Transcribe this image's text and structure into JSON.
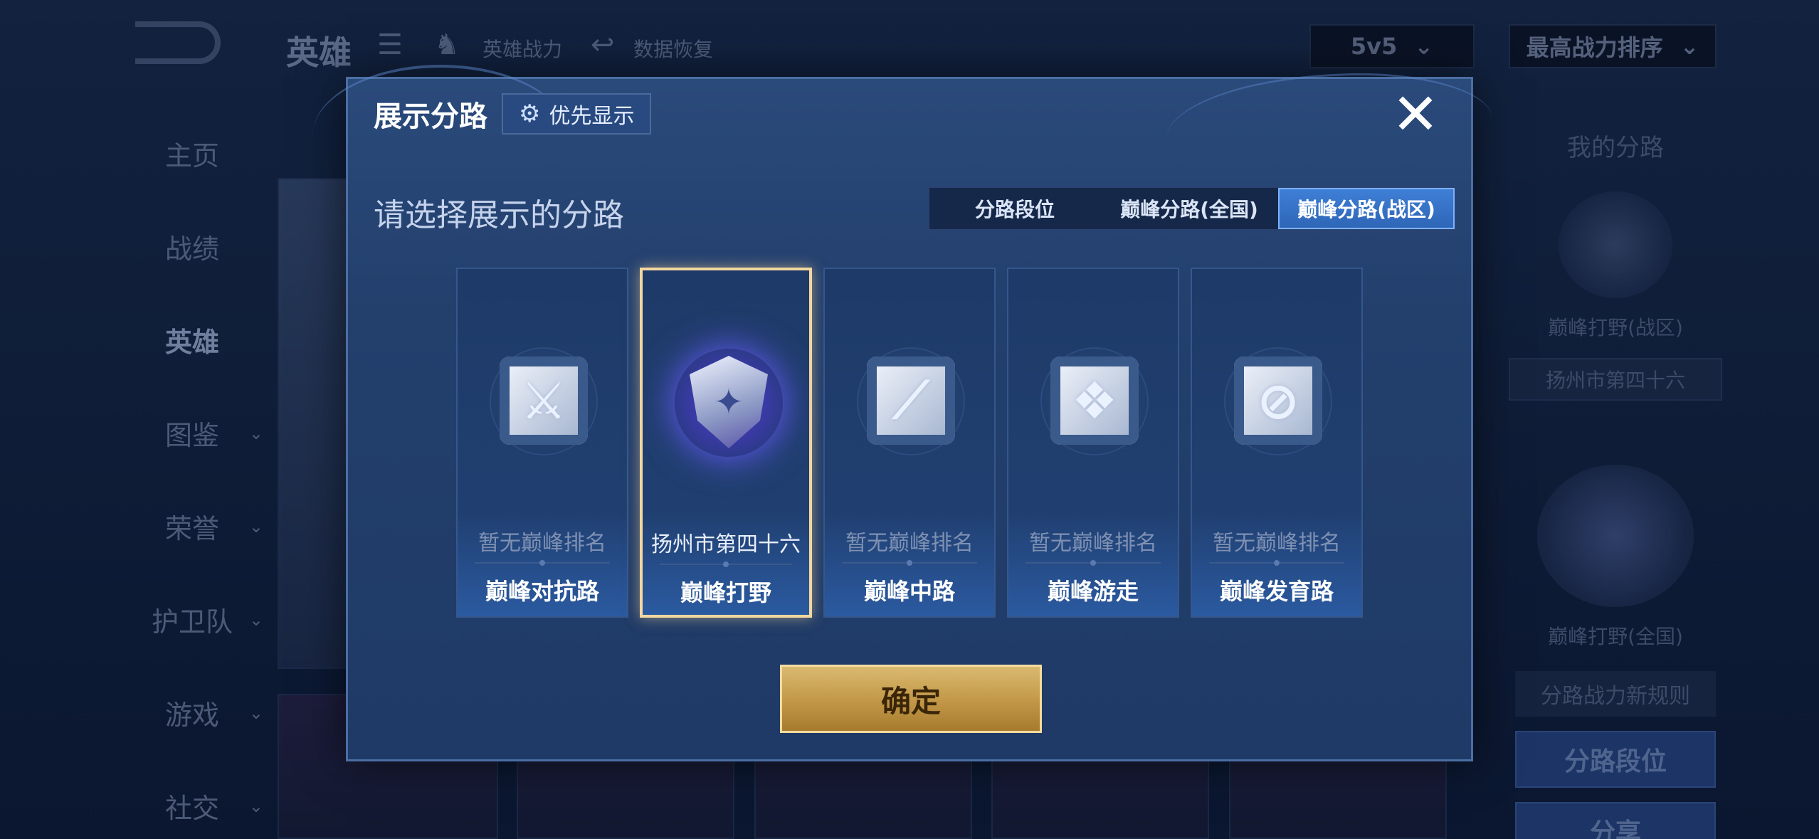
{
  "background": {
    "page_title": "英雄",
    "toolbar_links": [
      "英雄战力",
      "数据恢复"
    ],
    "mode_select": "5v5",
    "sort_select": "最高战力排序",
    "nav": [
      "主页",
      "战绩",
      "英雄",
      "图鉴",
      "荣誉",
      "护卫队",
      "游戏",
      "社交"
    ],
    "right_panel": {
      "title": "我的分路",
      "emblem1_caption": "巅峰打野(战区)",
      "emblem1_location": "扬州市第四十六",
      "emblem2_caption": "巅峰打野(全国)",
      "rules_link": "分路战力新规则",
      "lane_rank_button": "分路段位",
      "share_button": "分享"
    }
  },
  "modal": {
    "title": "展示分路",
    "priority_button": "优先显示",
    "subtitle": "请选择展示的分路",
    "tabs": [
      "分路段位",
      "巅峰分路(全国)",
      "巅峰分路(战区)"
    ],
    "active_tab": 2,
    "cards": [
      {
        "rank": "暂无巅峰排名",
        "lane": "巅峰对抗路",
        "icon": "clash-lane-icon",
        "selected": false
      },
      {
        "rank": "扬州市第四十六",
        "lane": "巅峰打野",
        "icon": "jungle-emblem-icon",
        "selected": true
      },
      {
        "rank": "暂无巅峰排名",
        "lane": "巅峰中路",
        "icon": "mid-lane-icon",
        "selected": false
      },
      {
        "rank": "暂无巅峰排名",
        "lane": "巅峰游走",
        "icon": "roam-icon",
        "selected": false
      },
      {
        "rank": "暂无巅峰排名",
        "lane": "巅峰发育路",
        "icon": "farm-lane-icon",
        "selected": false
      }
    ],
    "confirm_button": "确定"
  }
}
